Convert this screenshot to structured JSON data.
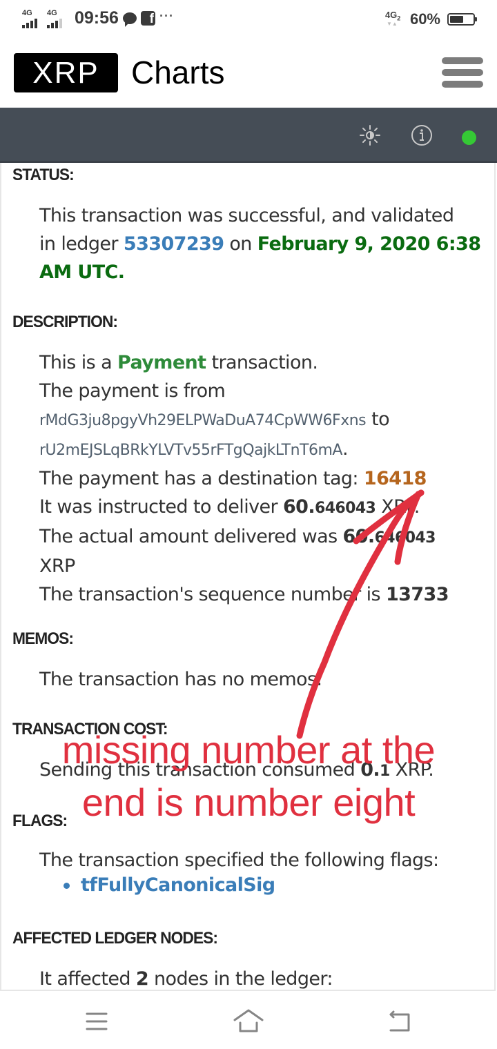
{
  "status_bar": {
    "signal1_label": "4G",
    "signal2_label": "4G",
    "time": "09:56",
    "notification_icons": [
      "chat-bubble-icon",
      "facebook-icon"
    ],
    "more_indicator": "···",
    "network_label": "4G",
    "network_sub": "2",
    "battery_percent_text": "60%",
    "battery_level": 0.6
  },
  "header": {
    "logo_text": "XRP",
    "title": "Charts",
    "menu_icon": "hamburger-menu-icon"
  },
  "toolbar": {
    "icons": [
      "theme-toggle-icon",
      "info-icon"
    ],
    "connection_status_color": "#35c935"
  },
  "sections": {
    "status": {
      "heading": "STATUS:",
      "text1": "This transaction was successful, and validated",
      "text2_prefix": "in ledger ",
      "ledger_index": "53307239",
      "text2_mid": " on ",
      "date_part1": "February 9, 2020 6:38",
      "date_part2": "AM UTC."
    },
    "description": {
      "heading": "DESCRIPTION:",
      "line1_prefix": "This is a ",
      "tx_type": "Payment",
      "line1_suffix": " transaction.",
      "line2": "The payment is from",
      "from_account": "rMdG3ju8pgyVh29ELPWaDuA74CpWW6Fxns",
      "to_word": " to",
      "to_account": "rU2mEJSLqBRkYLVTv55rFTgQajkLTnT6mA",
      "to_suffix": ".",
      "dest_tag_prefix": "The payment has a destination tag: ",
      "destination_tag": "16418",
      "instructed_prefix": "It was instructed to deliver ",
      "instructed_int": "60.",
      "instructed_dec": "646043",
      "instructed_suffix": " XRP.",
      "delivered_prefix": "The actual amount delivered was ",
      "delivered_int": "60.",
      "delivered_dec": "646043",
      "delivered_suffix": "XRP",
      "sequence_prefix": "The transaction's sequence number is ",
      "sequence": "13733"
    },
    "memos": {
      "heading": "MEMOS:",
      "text": "The transaction has no memos."
    },
    "transaction_cost": {
      "heading": "TRANSACTION COST:",
      "prefix": "Sending this transaction consumed ",
      "amount_int": "0.",
      "amount_dec": "1",
      "suffix": " XRP."
    },
    "flags": {
      "heading": "FLAGS:",
      "text": "The transaction specified the following flags:",
      "items": [
        "tfFullyCanonicalSig"
      ]
    },
    "affected_nodes": {
      "heading": "AFFECTED LEDGER NODES:",
      "prefix": "It affected ",
      "count": "2",
      "suffix": " nodes in the ledger:"
    }
  },
  "annotation": {
    "line1": "missing number at the",
    "line2": "end is number eight",
    "color": "#e0303f"
  },
  "nav_bar": {
    "buttons": [
      "recent-apps-icon",
      "home-icon",
      "back-icon"
    ]
  }
}
